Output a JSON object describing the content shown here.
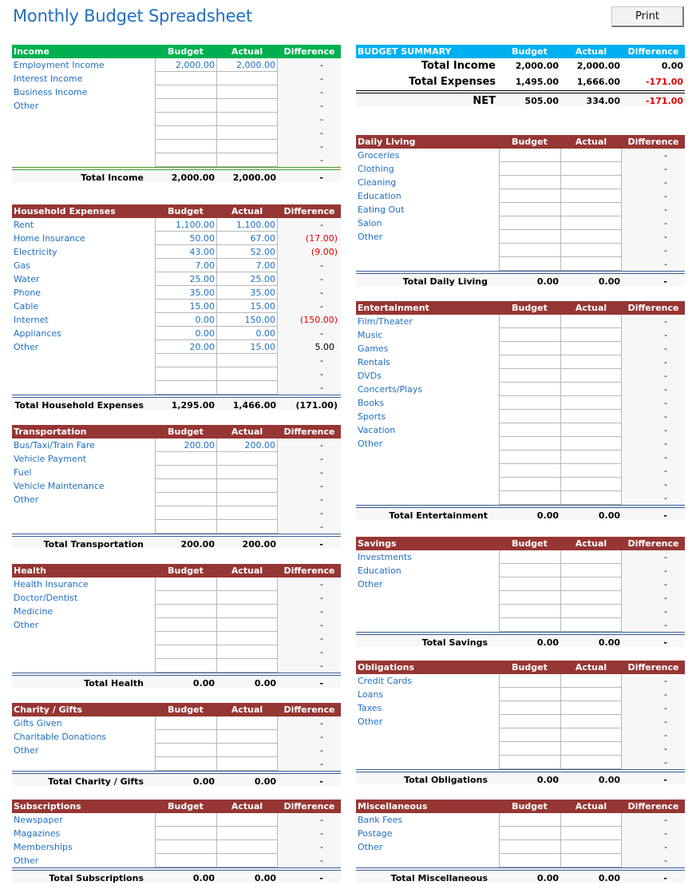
{
  "title": "Monthly Budget Spreadsheet",
  "print_label": "Print",
  "columns": {
    "budget": "Budget",
    "actual": "Actual",
    "difference": "Difference"
  },
  "summary": {
    "header": "BUDGET SUMMARY",
    "rows": [
      {
        "label": "Total Income",
        "budget": "2,000.00",
        "actual": "2,000.00",
        "difference": "0.00"
      },
      {
        "label": "Total Expenses",
        "budget": "1,495.00",
        "actual": "1,666.00",
        "difference": "-171.00"
      },
      {
        "label": "NET",
        "budget": "505.00",
        "actual": "334.00",
        "difference": "-171.00"
      }
    ]
  },
  "sections": {
    "income": {
      "header": "Income",
      "rows": [
        {
          "label": "Employment Income",
          "budget": "2,000.00",
          "actual": "2,000.00",
          "difference": "-"
        },
        {
          "label": "Interest Income",
          "budget": "",
          "actual": "",
          "difference": "-"
        },
        {
          "label": "Business Income",
          "budget": "",
          "actual": "",
          "difference": "-"
        },
        {
          "label": "Other",
          "budget": "",
          "actual": "",
          "difference": "-"
        },
        {
          "label": "",
          "budget": "",
          "actual": "",
          "difference": "-"
        },
        {
          "label": "",
          "budget": "",
          "actual": "",
          "difference": "-"
        },
        {
          "label": "",
          "budget": "",
          "actual": "",
          "difference": "-"
        },
        {
          "label": "",
          "budget": "",
          "actual": "",
          "difference": "-"
        }
      ],
      "total": {
        "label": "Total Income",
        "budget": "2,000.00",
        "actual": "2,000.00",
        "difference": "-"
      }
    },
    "household": {
      "header": "Household Expenses",
      "rows": [
        {
          "label": "Rent",
          "budget": "1,100.00",
          "actual": "1,100.00",
          "difference": "-"
        },
        {
          "label": "Home Insurance",
          "budget": "50.00",
          "actual": "67.00",
          "difference": "(17.00)"
        },
        {
          "label": "Electricity",
          "budget": "43.00",
          "actual": "52.00",
          "difference": "(9.00)"
        },
        {
          "label": "Gas",
          "budget": "7.00",
          "actual": "7.00",
          "difference": "-"
        },
        {
          "label": "Water",
          "budget": "25.00",
          "actual": "25.00",
          "difference": "-"
        },
        {
          "label": "Phone",
          "budget": "35.00",
          "actual": "35.00",
          "difference": "-"
        },
        {
          "label": "Cable",
          "budget": "15.00",
          "actual": "15.00",
          "difference": "-"
        },
        {
          "label": "Internet",
          "budget": "0.00",
          "actual": "150.00",
          "difference": "(150.00)"
        },
        {
          "label": "Appliances",
          "budget": "0.00",
          "actual": "0.00",
          "difference": "-"
        },
        {
          "label": "Other",
          "budget": "20.00",
          "actual": "15.00",
          "difference": "5.00"
        },
        {
          "label": "",
          "budget": "",
          "actual": "",
          "difference": "-"
        },
        {
          "label": "",
          "budget": "",
          "actual": "",
          "difference": "-"
        },
        {
          "label": "",
          "budget": "",
          "actual": "",
          "difference": "-"
        }
      ],
      "total": {
        "label": "Total Household Expenses",
        "budget": "1,295.00",
        "actual": "1,466.00",
        "difference": "(171.00)"
      }
    },
    "transportation": {
      "header": "Transportation",
      "rows": [
        {
          "label": "Bus/Taxi/Train Fare",
          "budget": "200.00",
          "actual": "200.00",
          "difference": "-"
        },
        {
          "label": "Vehicle Payment",
          "budget": "",
          "actual": "",
          "difference": "-"
        },
        {
          "label": "Fuel",
          "budget": "",
          "actual": "",
          "difference": "-"
        },
        {
          "label": "Vehicle Maintenance",
          "budget": "",
          "actual": "",
          "difference": "-"
        },
        {
          "label": "Other",
          "budget": "",
          "actual": "",
          "difference": "-"
        },
        {
          "label": "",
          "budget": "",
          "actual": "",
          "difference": "-"
        },
        {
          "label": "",
          "budget": "",
          "actual": "",
          "difference": "-"
        }
      ],
      "total": {
        "label": "Total Transportation",
        "budget": "200.00",
        "actual": "200.00",
        "difference": "-"
      }
    },
    "health": {
      "header": "Health",
      "rows": [
        {
          "label": "Health Insurance",
          "budget": "",
          "actual": "",
          "difference": "-"
        },
        {
          "label": "Doctor/Dentist",
          "budget": "",
          "actual": "",
          "difference": "-"
        },
        {
          "label": "Medicine",
          "budget": "",
          "actual": "",
          "difference": "-"
        },
        {
          "label": "Other",
          "budget": "",
          "actual": "",
          "difference": "-"
        },
        {
          "label": "",
          "budget": "",
          "actual": "",
          "difference": "-"
        },
        {
          "label": "",
          "budget": "",
          "actual": "",
          "difference": "-"
        },
        {
          "label": "",
          "budget": "",
          "actual": "",
          "difference": "-"
        }
      ],
      "total": {
        "label": "Total Health",
        "budget": "0.00",
        "actual": "0.00",
        "difference": "-"
      }
    },
    "charity": {
      "header": "Charity / Gifts",
      "rows": [
        {
          "label": "Gifts Given",
          "budget": "",
          "actual": "",
          "difference": "-"
        },
        {
          "label": "Charitable Donations",
          "budget": "",
          "actual": "",
          "difference": "-"
        },
        {
          "label": "Other",
          "budget": "",
          "actual": "",
          "difference": "-"
        },
        {
          "label": "",
          "budget": "",
          "actual": "",
          "difference": "-"
        }
      ],
      "total": {
        "label": "Total Charity / Gifts",
        "budget": "0.00",
        "actual": "0.00",
        "difference": "-"
      }
    },
    "subscriptions": {
      "header": "Subscriptions",
      "rows": [
        {
          "label": "Newspaper",
          "budget": "",
          "actual": "",
          "difference": "-"
        },
        {
          "label": "Magazines",
          "budget": "",
          "actual": "",
          "difference": "-"
        },
        {
          "label": "Memberships",
          "budget": "",
          "actual": "",
          "difference": "-"
        },
        {
          "label": "Other",
          "budget": "",
          "actual": "",
          "difference": "-"
        }
      ],
      "total": {
        "label": "Total Subscriptions",
        "budget": "0.00",
        "actual": "0.00",
        "difference": "-"
      }
    },
    "daily_living": {
      "header": "Daily Living",
      "rows": [
        {
          "label": "Groceries",
          "budget": "",
          "actual": "",
          "difference": "-"
        },
        {
          "label": "Clothing",
          "budget": "",
          "actual": "",
          "difference": "-"
        },
        {
          "label": "Cleaning",
          "budget": "",
          "actual": "",
          "difference": "-"
        },
        {
          "label": "Education",
          "budget": "",
          "actual": "",
          "difference": "-"
        },
        {
          "label": "Eating Out",
          "budget": "",
          "actual": "",
          "difference": "-"
        },
        {
          "label": "Salon",
          "budget": "",
          "actual": "",
          "difference": "-"
        },
        {
          "label": "Other",
          "budget": "",
          "actual": "",
          "difference": "-"
        },
        {
          "label": "",
          "budget": "",
          "actual": "",
          "difference": "-"
        },
        {
          "label": "",
          "budget": "",
          "actual": "",
          "difference": "-"
        }
      ],
      "total": {
        "label": "Total Daily Living",
        "budget": "0.00",
        "actual": "0.00",
        "difference": "-"
      }
    },
    "entertainment": {
      "header": "Entertainment",
      "rows": [
        {
          "label": "Film/Theater",
          "budget": "",
          "actual": "",
          "difference": "-"
        },
        {
          "label": "Music",
          "budget": "",
          "actual": "",
          "difference": "-"
        },
        {
          "label": "Games",
          "budget": "",
          "actual": "",
          "difference": "-"
        },
        {
          "label": "Rentals",
          "budget": "",
          "actual": "",
          "difference": "-"
        },
        {
          "label": "DVDs",
          "budget": "",
          "actual": "",
          "difference": "-"
        },
        {
          "label": "Concerts/Plays",
          "budget": "",
          "actual": "",
          "difference": "-"
        },
        {
          "label": "Books",
          "budget": "",
          "actual": "",
          "difference": "-"
        },
        {
          "label": "Sports",
          "budget": "",
          "actual": "",
          "difference": "-"
        },
        {
          "label": "Vacation",
          "budget": "",
          "actual": "",
          "difference": "-"
        },
        {
          "label": "Other",
          "budget": "",
          "actual": "",
          "difference": "-"
        },
        {
          "label": "",
          "budget": "",
          "actual": "",
          "difference": "-"
        },
        {
          "label": "",
          "budget": "",
          "actual": "",
          "difference": "-"
        },
        {
          "label": "",
          "budget": "",
          "actual": "",
          "difference": "-"
        },
        {
          "label": "",
          "budget": "",
          "actual": "",
          "difference": "-"
        }
      ],
      "total": {
        "label": "Total Entertainment",
        "budget": "0.00",
        "actual": "0.00",
        "difference": "-"
      }
    },
    "savings": {
      "header": "Savings",
      "rows": [
        {
          "label": "Investments",
          "budget": "",
          "actual": "",
          "difference": "-"
        },
        {
          "label": "Education",
          "budget": "",
          "actual": "",
          "difference": "-"
        },
        {
          "label": "Other",
          "budget": "",
          "actual": "",
          "difference": "-"
        },
        {
          "label": "",
          "budget": "",
          "actual": "",
          "difference": "-"
        },
        {
          "label": "",
          "budget": "",
          "actual": "",
          "difference": "-"
        },
        {
          "label": "",
          "budget": "",
          "actual": "",
          "difference": "-"
        }
      ],
      "total": {
        "label": "Total Savings",
        "budget": "0.00",
        "actual": "0.00",
        "difference": "-"
      }
    },
    "obligations": {
      "header": "Obligations",
      "rows": [
        {
          "label": "Credit Cards",
          "budget": "",
          "actual": "",
          "difference": "-"
        },
        {
          "label": "Loans",
          "budget": "",
          "actual": "",
          "difference": "-"
        },
        {
          "label": "Taxes",
          "budget": "",
          "actual": "",
          "difference": "-"
        },
        {
          "label": "Other",
          "budget": "",
          "actual": "",
          "difference": "-"
        },
        {
          "label": "",
          "budget": "",
          "actual": "",
          "difference": "-"
        },
        {
          "label": "",
          "budget": "",
          "actual": "",
          "difference": "-"
        },
        {
          "label": "",
          "budget": "",
          "actual": "",
          "difference": "-"
        }
      ],
      "total": {
        "label": "Total Obligations",
        "budget": "0.00",
        "actual": "0.00",
        "difference": "-"
      }
    },
    "miscellaneous": {
      "header": "Miscellaneous",
      "rows": [
        {
          "label": "Bank Fees",
          "budget": "",
          "actual": "",
          "difference": "-"
        },
        {
          "label": "Postage",
          "budget": "",
          "actual": "",
          "difference": "-"
        },
        {
          "label": "Other",
          "budget": "",
          "actual": "",
          "difference": "-"
        },
        {
          "label": "",
          "budget": "",
          "actual": "",
          "difference": "-"
        }
      ],
      "total": {
        "label": "Total Miscellaneous",
        "budget": "0.00",
        "actual": "0.00",
        "difference": "-"
      }
    }
  },
  "colors": {
    "title": "#1f6fc0",
    "income_header": "#00b050",
    "summary_header": "#00b0f0",
    "section_header": "#963634",
    "negative": "#e00000",
    "total_rule": "#3a5f9a"
  }
}
